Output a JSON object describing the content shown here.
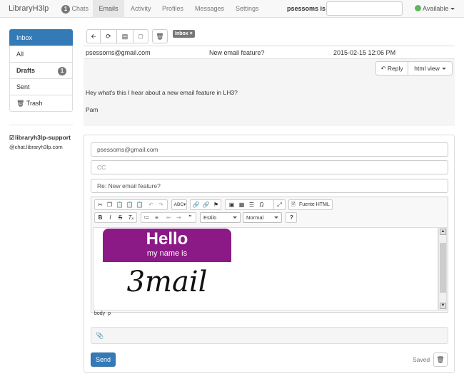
{
  "app": {
    "brand": "LibraryH3lp"
  },
  "nav": {
    "chats_count": "1",
    "chats_label": "Chats",
    "emails": "Emails",
    "activity": "Activity",
    "profiles": "Profiles",
    "messages": "Messages",
    "settings": "Settings",
    "status_prefix": "psessoms is",
    "available": "Available"
  },
  "sidebar": {
    "folders": [
      {
        "label": "Inbox"
      },
      {
        "label": "All"
      },
      {
        "label": "Drafts",
        "count": "1"
      },
      {
        "label": "Sent"
      },
      {
        "label": "Trash"
      }
    ],
    "contact": {
      "name": "libraryh3lp-support",
      "address": "@chat.libraryh3lp.com"
    }
  },
  "toolbar": {
    "inbox_label": "Inbox"
  },
  "message": {
    "from": "psessoms@gmail.com",
    "subject": "New email feature?",
    "date": "2015-02-15 12:06 PM",
    "reply_label": "Reply",
    "view_label": "html view",
    "body_line1": "Hey what's this I hear about a new email feature in LH3?",
    "body_line2": "Pam"
  },
  "compose": {
    "to": "psessoms@gmail.com",
    "cc_placeholder": "CC",
    "subject": "Re: New email feature?",
    "source_label": "Fuente HTML",
    "style_label": "Estilo",
    "format_label": "Normal",
    "path_body": "body",
    "path_p": "p",
    "image": {
      "hello": "Hello",
      "my_name_is": "my name is",
      "name": "3mail"
    },
    "send_label": "Send",
    "saved_label": "Saved"
  },
  "colors": {
    "primary": "#337ab7",
    "available": "#5cb85c",
    "badge": "#777777",
    "nametag": "#8b1a86"
  }
}
